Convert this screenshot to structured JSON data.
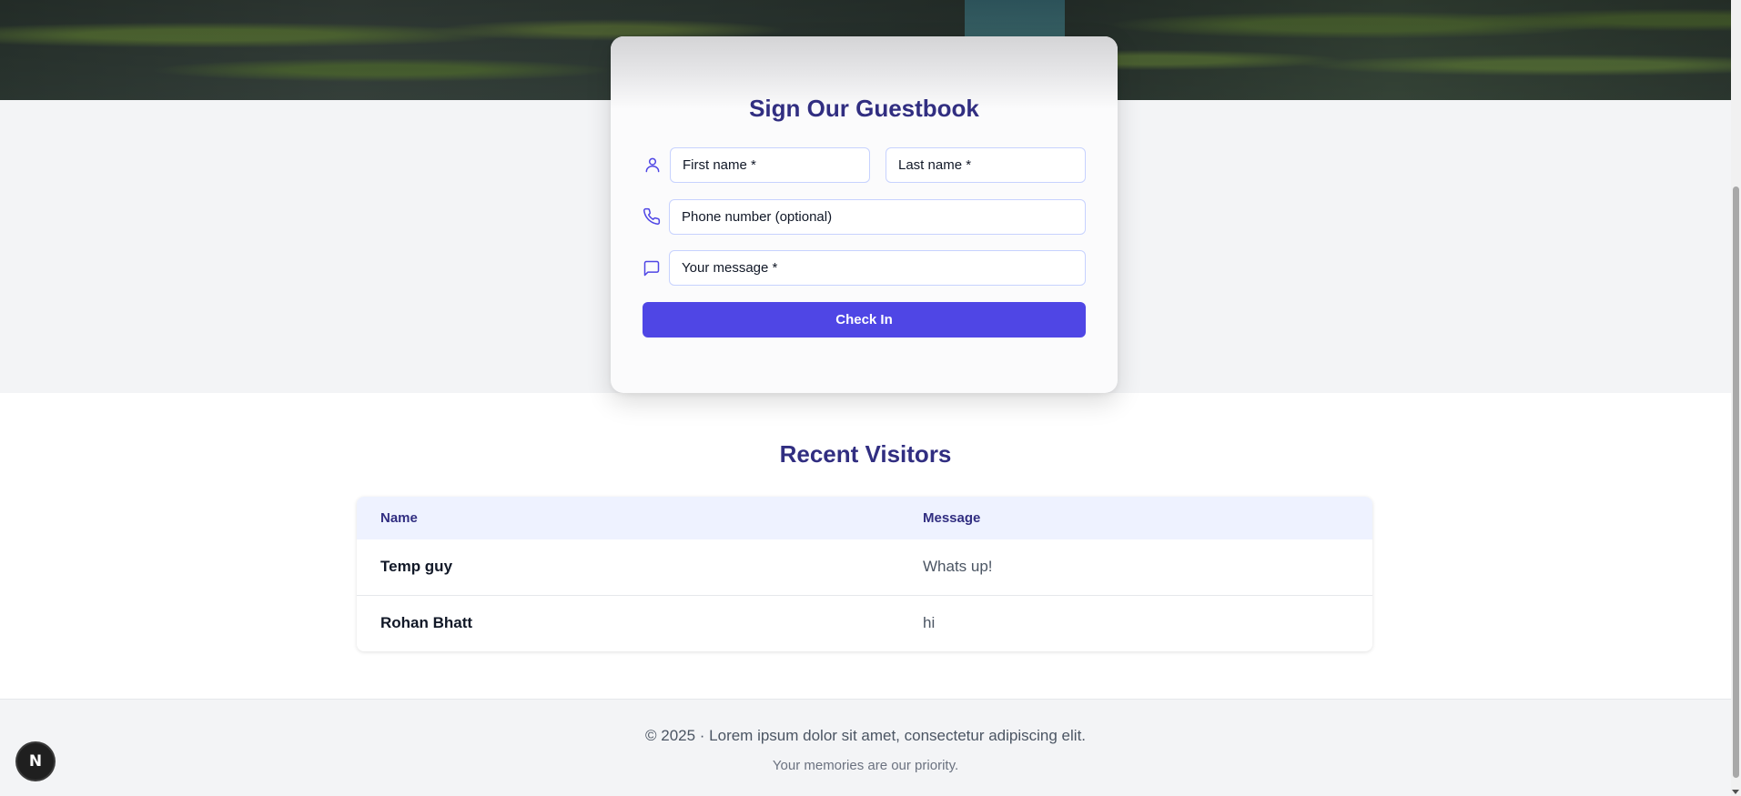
{
  "guestbook": {
    "title": "Sign Our Guestbook",
    "first_name_placeholder": "First name *",
    "last_name_placeholder": "Last name *",
    "phone_placeholder": "Phone number (optional)",
    "message_placeholder": "Your message *",
    "submit_label": "Check In",
    "accent_color": "#4f46e5",
    "icons": [
      "user-icon",
      "phone-icon",
      "message-icon"
    ]
  },
  "visitors": {
    "title": "Recent Visitors",
    "columns": [
      "Name",
      "Message"
    ],
    "rows": [
      {
        "name": "Temp guy",
        "message": "Whats up!"
      },
      {
        "name": "Rohan Bhatt",
        "message": "hi"
      }
    ]
  },
  "footer": {
    "copyright": "© 2025 · Lorem ipsum dolor sit amet, consectetur adipiscing elit.",
    "tagline": "Your memories are our priority."
  },
  "dev_badge": {
    "letter": "N"
  }
}
